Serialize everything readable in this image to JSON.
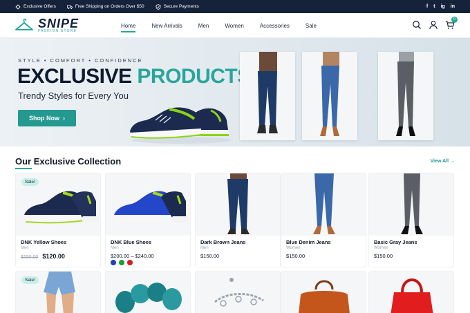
{
  "topbar": {
    "offers": "Exclusive Offers",
    "shipping": "Free Shipping on Orders Over $50",
    "payments": "Secure Payments",
    "social": [
      "f",
      "t",
      "ig",
      "in"
    ]
  },
  "header": {
    "logo_name": "SNIPE",
    "logo_sub": "FASHION STORE",
    "nav": [
      "Home",
      "New Arrivals",
      "Men",
      "Women",
      "Accessories",
      "Sale"
    ],
    "active_nav": "Home",
    "cart_count": "0"
  },
  "hero": {
    "tagline": "STYLE • COMFORT • CONFIDENCE",
    "title_part1": "EXCLUSIVE",
    "title_part2": "PRODUCTS",
    "subtitle": "Trendy Styles for Every You",
    "cta": "Shop Now"
  },
  "collection": {
    "title": "Our Exclusive Collection",
    "view_all": "View All →",
    "products": [
      {
        "name": "DNK Yellow Shoes",
        "category": "Men",
        "old_price": "$150.00",
        "price": "$120.00",
        "sale": "Sale!"
      },
      {
        "name": "DNK Blue Shoes",
        "category": "Men",
        "price": "$200.00 – $240.00",
        "swatches": [
          "#1d3fbf",
          "#1e9d3a",
          "#d21f1f"
        ]
      },
      {
        "name": "Dark Brown Jeans",
        "category": "Men",
        "price": "$150.00"
      },
      {
        "name": "Blue Denim Jeans",
        "category": "Women",
        "price": "$150.00"
      },
      {
        "name": "Basic Gray Jeans",
        "category": "Women",
        "price": "$150.00"
      }
    ],
    "row2_sale": "Sale!"
  },
  "colors": {
    "accent": "#2aa59b",
    "navy": "#16213a"
  }
}
